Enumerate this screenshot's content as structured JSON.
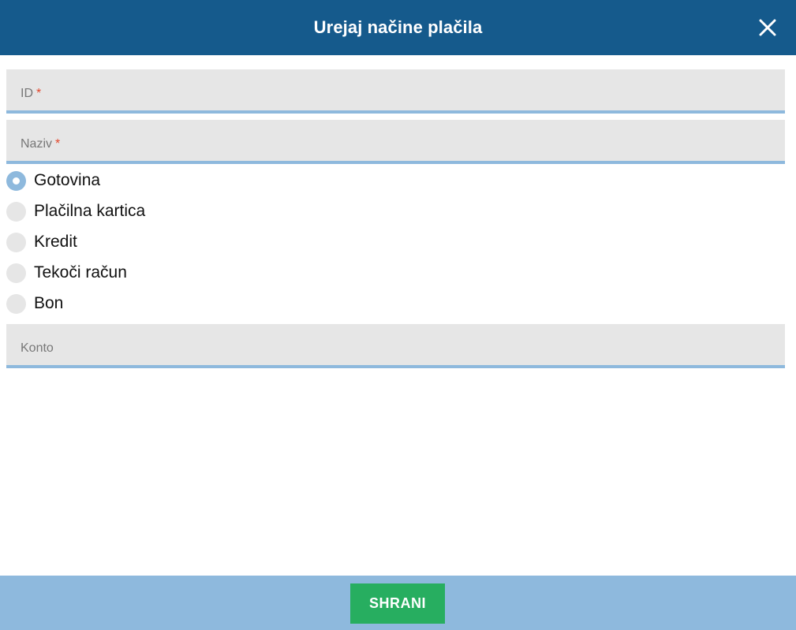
{
  "dialog": {
    "title": "Urejaj načine plačila",
    "close_icon": "close-icon"
  },
  "form": {
    "id_field": {
      "label": "ID",
      "required_mark": "*",
      "value": ""
    },
    "name_field": {
      "label": "Naziv",
      "required_mark": "*",
      "value": ""
    },
    "payment_types": [
      {
        "label": "Gotovina",
        "checked": true
      },
      {
        "label": "Plačilna kartica",
        "checked": false
      },
      {
        "label": "Kredit",
        "checked": false
      },
      {
        "label": "Tekoči račun",
        "checked": false
      },
      {
        "label": "Bon",
        "checked": false
      }
    ],
    "account_field": {
      "label": "Konto",
      "value": ""
    }
  },
  "footer": {
    "save_label": "SHRANI"
  },
  "colors": {
    "header_bg": "#155a8c",
    "field_bg": "#e6e6e6",
    "accent": "#8eb9dd",
    "required": "#e2472c",
    "save_bg": "#27ae60"
  }
}
